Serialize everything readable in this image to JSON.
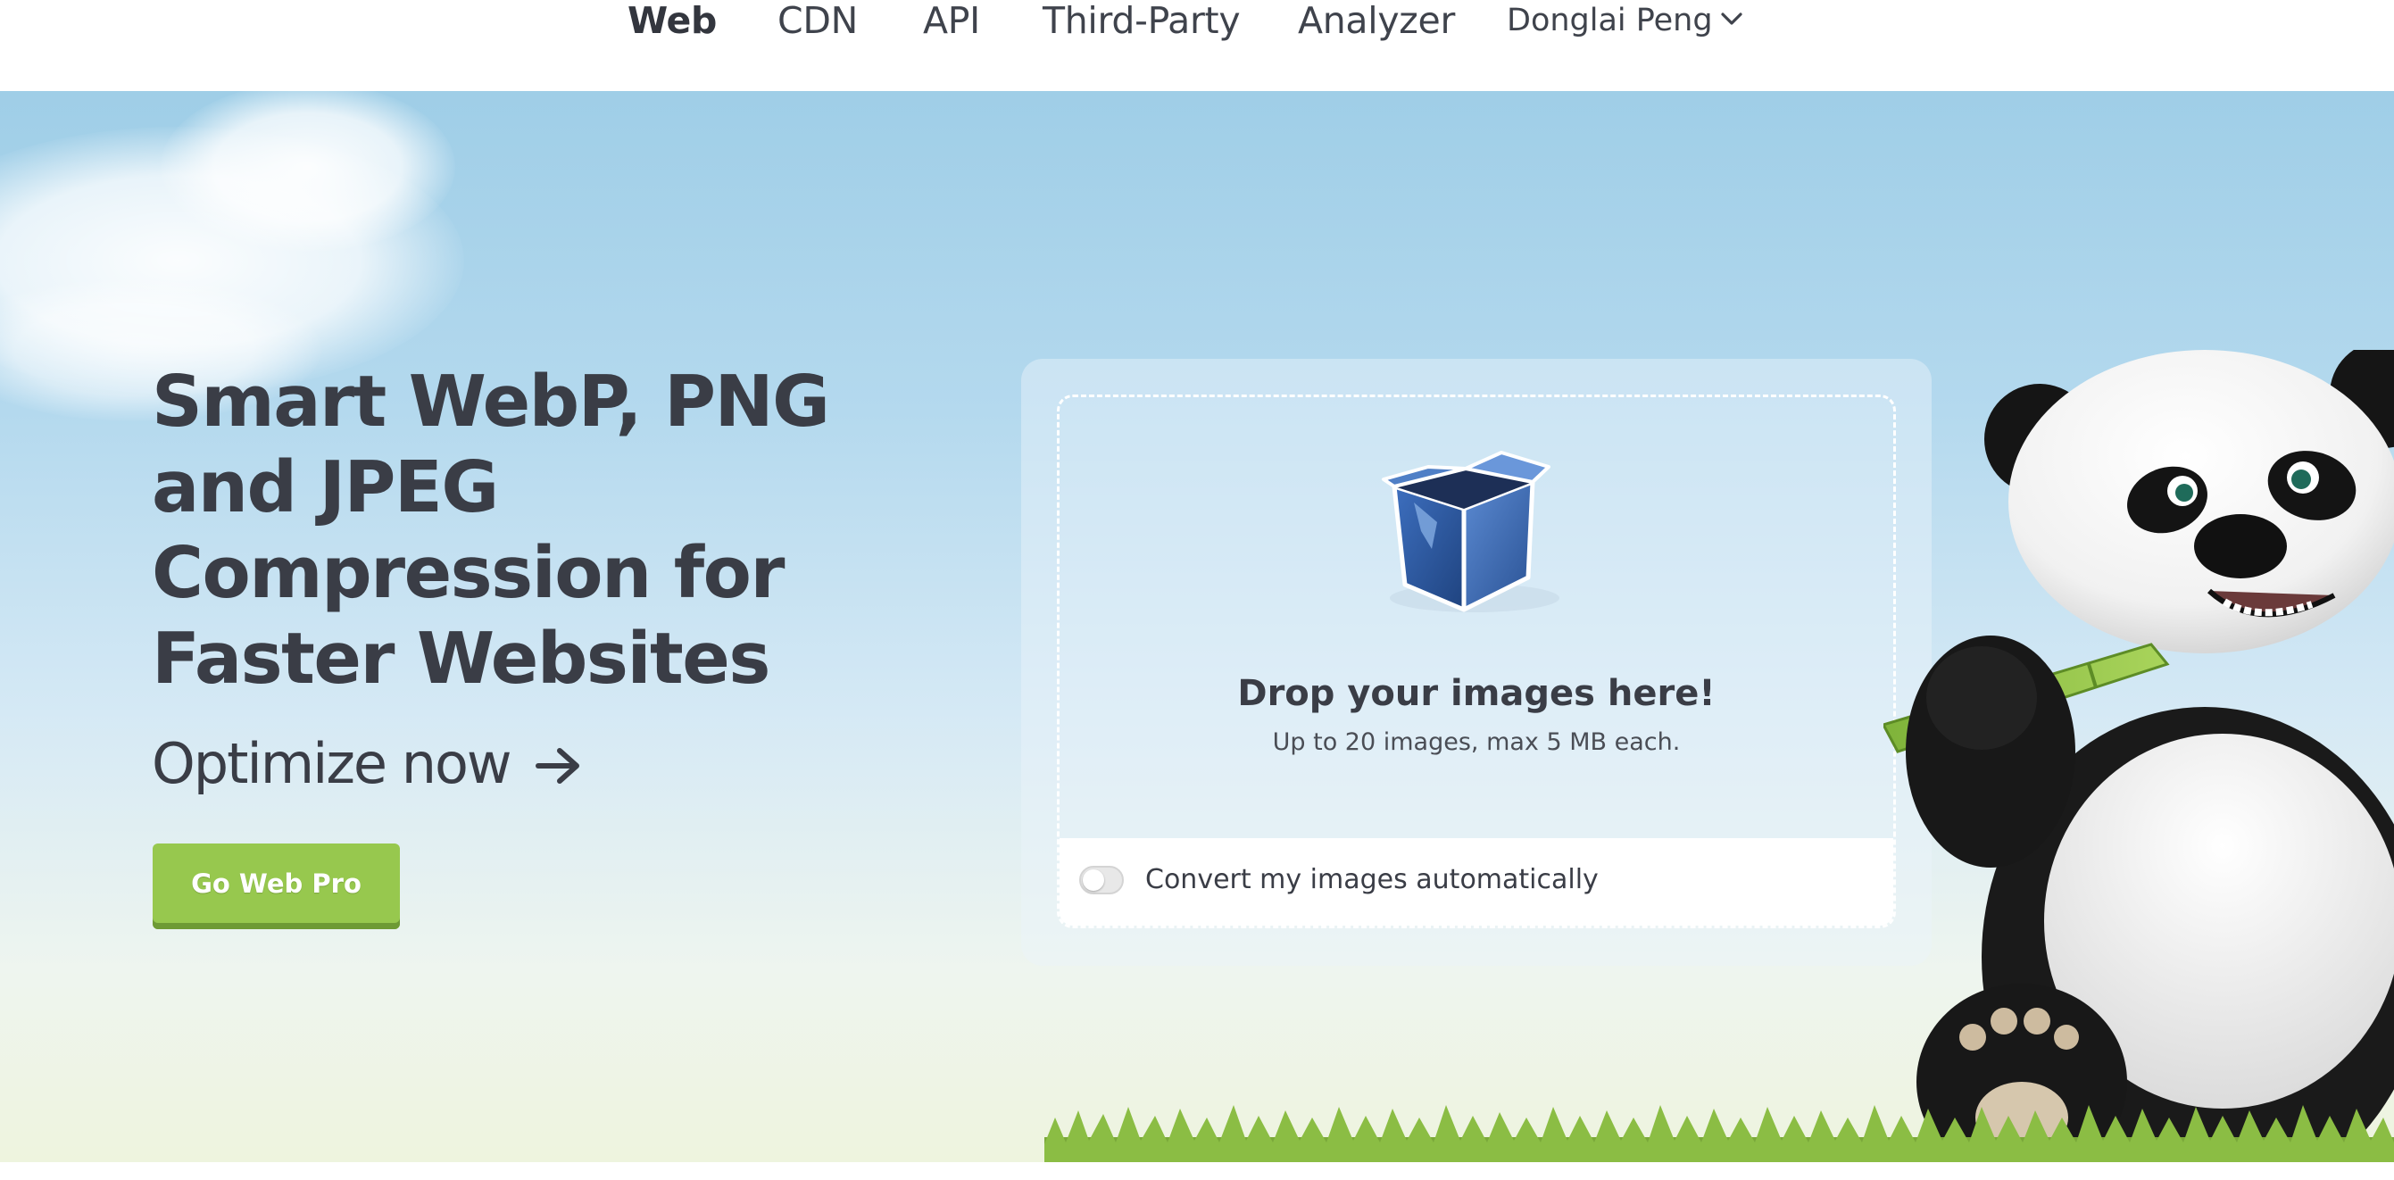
{
  "nav": {
    "items": [
      {
        "label": "Web",
        "active": true
      },
      {
        "label": "CDN",
        "active": false
      },
      {
        "label": "API",
        "active": false
      },
      {
        "label": "Third-Party",
        "active": false
      },
      {
        "label": "Analyzer",
        "active": false
      }
    ],
    "user": {
      "name": "Donglai Peng",
      "icon": "chevron-down-icon"
    }
  },
  "hero": {
    "headline": "Smart WebP, PNG and JPEG Compression for Faster Websites",
    "subline": "Optimize now",
    "subline_icon": "arrow-right-icon",
    "cta_label": "Go Web Pro"
  },
  "upload": {
    "icon": "box-icon",
    "title": "Drop your images here!",
    "subtitle": "Up to 20 images, max 5 MB each.",
    "convert_label": "Convert my images automatically",
    "convert_enabled": false
  },
  "colors": {
    "accent_green": "#97c84e",
    "text_dark": "#3a3d46",
    "sky_top": "#9fcee7",
    "box_blue": "#2f5ea8"
  }
}
